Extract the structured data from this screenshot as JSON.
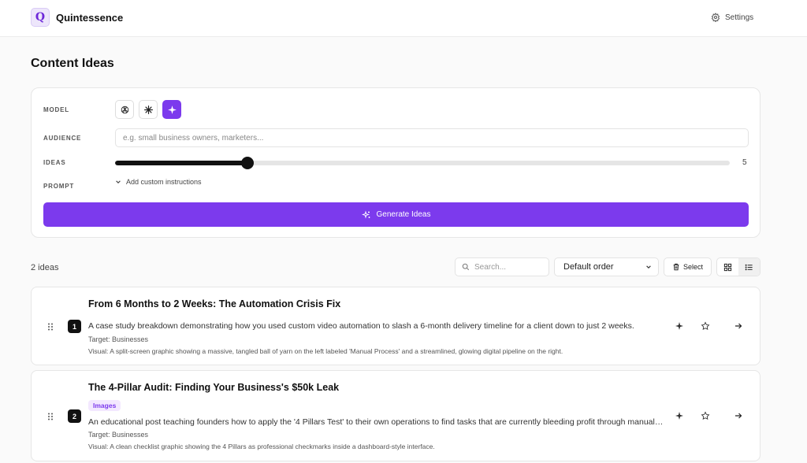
{
  "app": {
    "logo_letter": "Q",
    "name": "Quintessence",
    "settings_label": "Settings"
  },
  "page": {
    "title": "Content Ideas"
  },
  "form": {
    "model_label": "MODEL",
    "models": [
      "openai-icon",
      "asterisk-icon",
      "sparkle-icon"
    ],
    "audience_label": "AUDIENCE",
    "audience_placeholder": "e.g. small business owners, marketers...",
    "audience_value": "",
    "ideas_label": "IDEAS",
    "ideas_value": "5",
    "ideas_fraction": 0.216,
    "prompt_label": "PROMPT",
    "custom_instructions_label": "Add custom instructions",
    "generate_label": "Generate Ideas"
  },
  "toolbar": {
    "count_label": "2 ideas",
    "search_placeholder": "Search...",
    "order_value": "Default order",
    "select_label": "Select"
  },
  "ideas": [
    {
      "number": "1",
      "title": "From 6 Months to 2 Weeks: The Automation Crisis Fix",
      "tag": "",
      "description": "A case study breakdown demonstrating how you used custom video automation to slash a 6-month delivery timeline for a client down to just 2 weeks.",
      "target": "Target: Businesses",
      "visual": "Visual: A split-screen graphic showing a massive, tangled ball of yarn on the left labeled 'Manual Process' and a streamlined, glowing digital pipeline on the right."
    },
    {
      "number": "2",
      "title": "The 4-Pillar Audit: Finding Your Business's $50k Leak",
      "tag": "Images",
      "description": "An educational post teaching founders how to apply the '4 Pillars Test' to their own operations to find tasks that are currently bleeding profit through manual work.",
      "target": "Target: Businesses",
      "visual": "Visual: A clean checklist graphic showing the 4 Pillars as professional checkmarks inside a dashboard-style interface."
    }
  ],
  "colors": {
    "accent": "#7c3aed",
    "accent_light": "#f3e8ff"
  }
}
